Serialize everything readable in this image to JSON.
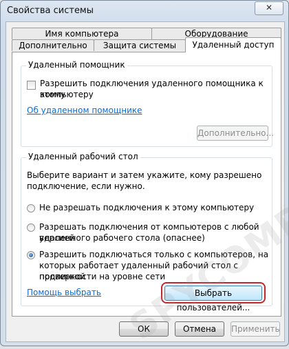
{
  "window": {
    "title": "Свойства системы"
  },
  "tabs": {
    "computer_name": "Имя компьютера",
    "hardware": "Оборудование",
    "advanced": "Дополнительно",
    "protection": "Защита системы",
    "remote": "Удаленный доступ"
  },
  "remote_assistance": {
    "legend": "Удаленный помощник",
    "checkbox_line1": "Разрешить подключения удаленного помощника к этому",
    "checkbox_line2": "компьютеру",
    "checkbox_checked": false,
    "link": "Об удаленном помощнике",
    "advanced_button": "Дополнительно..."
  },
  "remote_desktop": {
    "legend": "Удаленный рабочий стол",
    "intro_line1": "Выберите вариант и затем укажите, кому разрешено",
    "intro_line2": "подключение, если нужно.",
    "option1": "Не разрешать подключения к этому компьютеру",
    "option2_line1": "Разрешать подключения от компьютеров с любой версией",
    "option2_line2": "удаленного рабочего стола (опаснее)",
    "option3_line1": "Разрешить подключаться только с компьютеров, на",
    "option3_line2": "которых работает удаленный рабочий стол с проверкой",
    "option3_line3": "подлинности на уровне сети",
    "selected_option": 3,
    "help_link": "Помощь выбрать",
    "select_users_button": "Выбрать пользователей..."
  },
  "footer": {
    "ok": "ОК",
    "cancel": "Отмена",
    "apply": "Применить"
  },
  "watermark": "SPYCOMP.COM",
  "colors": {
    "link": "#0a6cd6",
    "highlight": "#c0272d"
  }
}
